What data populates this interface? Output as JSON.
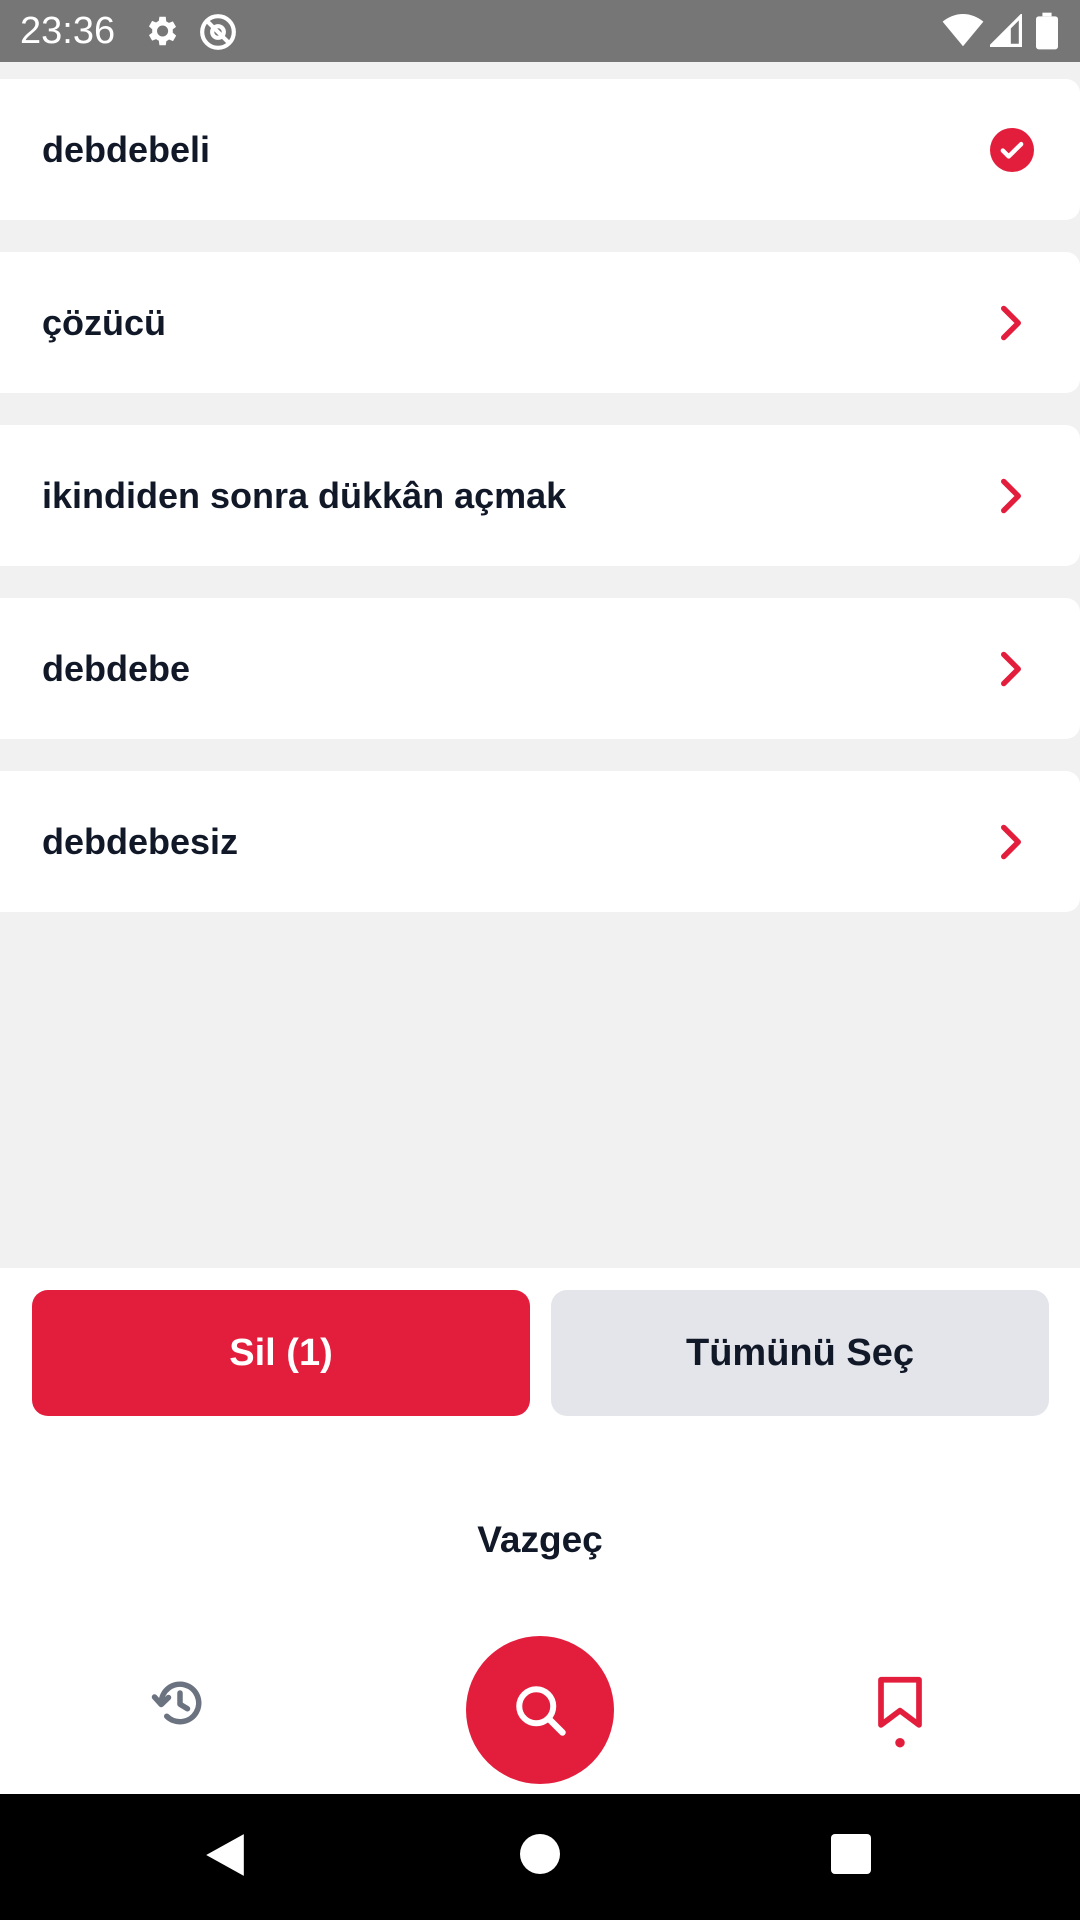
{
  "status_bar": {
    "time": "23:36",
    "icons": [
      "settings-icon",
      "at-sign-icon",
      "wifi-icon",
      "signal-icon",
      "battery-icon"
    ]
  },
  "list": {
    "items": [
      {
        "label": "debdebeli",
        "trailing_icon": "check-circle-icon",
        "selected": true
      },
      {
        "label": "çözücü",
        "trailing_icon": "chevron-right-icon",
        "selected": false
      },
      {
        "label": "ikindiden sonra dükkân açmak",
        "trailing_icon": "chevron-right-icon",
        "selected": false
      },
      {
        "label": "debdebe",
        "trailing_icon": "chevron-right-icon",
        "selected": false
      },
      {
        "label": "debdebesiz",
        "trailing_icon": "chevron-right-icon",
        "selected": false
      }
    ]
  },
  "actions": {
    "delete_label": "Sil (1)",
    "select_all_label": "Tümünü Seç",
    "cancel_label": "Vazgeç"
  },
  "bottom_nav": {
    "items": [
      {
        "name": "history",
        "icon": "history-icon"
      },
      {
        "name": "search",
        "icon": "search-icon"
      },
      {
        "name": "bookmarks",
        "icon": "bookmark-icon",
        "active": true
      }
    ]
  },
  "colors": {
    "accent": "#e31e3d",
    "background": "#f1f1f2",
    "text": "#111827",
    "secondary_button": "#e4e5ea"
  }
}
